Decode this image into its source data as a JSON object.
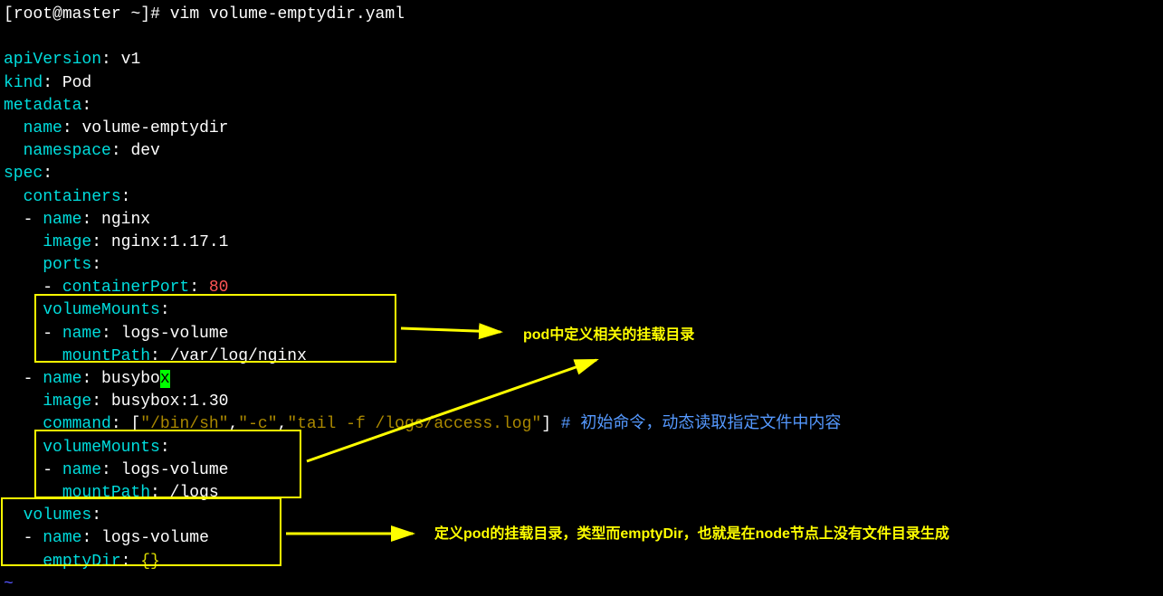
{
  "prompt": {
    "user": "root",
    "host": "master",
    "path": "~",
    "symbol": "#",
    "command": "vim volume-emptydir.yaml"
  },
  "yaml": {
    "apiVersion": "apiVersion",
    "apiVersionVal": " v1",
    "kind": "kind",
    "kindVal": " Pod",
    "metadata": "metadata",
    "metadataName": "name",
    "metadataNameVal": " volume-emptydir",
    "namespace": "namespace",
    "namespaceVal": " dev",
    "spec": "spec",
    "containers": "containers",
    "c1name": "name",
    "c1nameVal": " nginx",
    "c1image": "image",
    "c1imageVal": " nginx:1.17.1",
    "c1ports": "ports",
    "c1containerPort": "containerPort",
    "c1containerPortVal": " 80",
    "c1volumeMounts": "volumeMounts",
    "c1vmName": "name",
    "c1vmNameVal": " logs-volume",
    "c1vmMountPath": "mountPath",
    "c1vmMountPathVal": " /var/log/nginx",
    "c2name": "name",
    "c2nameVal": " busybo",
    "c2nameCursor": "x",
    "c2image": "image",
    "c2imageVal": " busybox:1.30",
    "c2command": "command",
    "c2commandBracket1": " [",
    "c2commandStr1": "\"/bin/sh\"",
    "c2commandComma1": ",",
    "c2commandStr2": "\"-c\"",
    "c2commandComma2": ",",
    "c2commandStr3": "\"tail -f /logs/access.log\"",
    "c2commandBracket2": "]",
    "c2commandComment": " # 初始命令，动态读取指定文件中内容",
    "c2volumeMounts": "volumeMounts",
    "c2vmName": "name",
    "c2vmNameVal": " logs-volume",
    "c2vmMountPath": "mountPath",
    "c2vmMountPathVal": " /logs",
    "volumes": "volumes",
    "volName": "name",
    "volNameVal": " logs-volume",
    "emptyDir": "emptyDir",
    "emptyDirVal": " {}"
  },
  "annotations": {
    "a1": "pod中定义相关的挂载目录",
    "a2": "定义pod的挂载目录，类型而emptyDir，也就是在node节点上没有文件目录生成"
  },
  "tilde": "~"
}
